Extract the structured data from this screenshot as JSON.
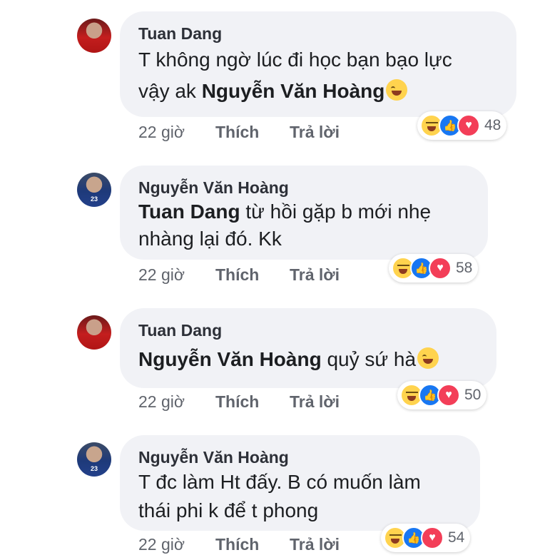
{
  "comments": [
    {
      "author": "Tuan Dang",
      "text_line1": "T không ngờ lúc đi học bạn bạo lực",
      "text_line2_pre": "vậy ak ",
      "mention": "Nguyễn Văn Hoàng",
      "text_post": "",
      "time": "22 giờ",
      "like_label": "Thích",
      "reply_label": "Trả lời",
      "reaction_count": "48",
      "avatar_color": "#c41e1e"
    },
    {
      "author": "Nguyễn Văn Hoàng",
      "mention": "Tuan Dang",
      "text_line1_post": " từ hồi gặp b mới nhẹ",
      "text_line2": "nhàng lại đó. Kk",
      "time": "22 giờ",
      "like_label": "Thích",
      "reply_label": "Trả lời",
      "reaction_count": "58",
      "avatar_number": "23",
      "avatar_color": "#1e3a7a"
    },
    {
      "author": "Tuan Dang",
      "mention": "Nguyễn Văn Hoàng",
      "text_post": " quỷ sứ hà",
      "time": "22 giờ",
      "like_label": "Thích",
      "reply_label": "Trả lời",
      "reaction_count": "50",
      "avatar_color": "#c41e1e"
    },
    {
      "author": "Nguyễn Văn Hoàng",
      "text_line1": "T đc làm Ht đấy. B có muốn làm",
      "text_line2": "thái phi k để t phong",
      "time": "22 giờ",
      "like_label": "Thích",
      "reply_label": "Trả lời",
      "reaction_count": "54",
      "avatar_number": "23",
      "avatar_color": "#1e3a7a"
    }
  ],
  "icons": {
    "haha": "haha-reaction-icon",
    "like": "like-reaction-icon",
    "love": "love-reaction-icon"
  }
}
